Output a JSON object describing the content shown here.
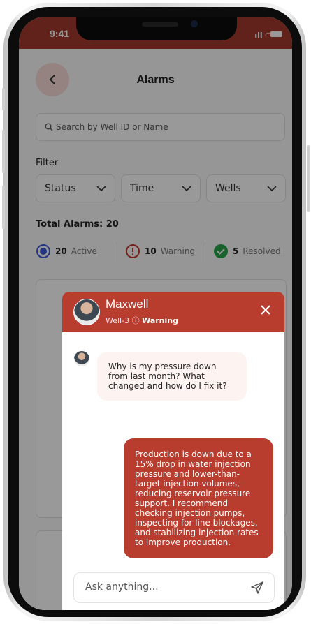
{
  "status_bar": {
    "time": "9:41"
  },
  "header": {
    "title": "Alarms",
    "back_icon": "chevron-left-icon"
  },
  "search": {
    "placeholder": "Search by Well ID or Name"
  },
  "filter": {
    "label": "Filter",
    "dropdowns": [
      {
        "label": "Status"
      },
      {
        "label": "Time"
      },
      {
        "label": "Wells"
      }
    ]
  },
  "total_alarms": "Total Alarms: 20",
  "stats": [
    {
      "count": "20",
      "label": "Active",
      "color": "#3d5bd9"
    },
    {
      "count": "10",
      "label": "Warning",
      "color": "#c0392b"
    },
    {
      "count": "5",
      "label": "Resolved",
      "color": "#27a348"
    }
  ],
  "chat": {
    "contact_name": "Maxwell",
    "well": "Well-3",
    "status": "Warning",
    "messages": [
      {
        "from": "user",
        "text": "Why is my pressure down from last month? What changed and how do I fix it?"
      },
      {
        "from": "assistant",
        "text": "Production is down due to a 15% drop in water injection pressure and lower-than-target injection volumes, reducing reservoir pressure support. I recommend checking injection pumps, inspecting for line blockages, and stabilizing injection rates to improve production."
      }
    ],
    "input_placeholder": "Ask anything...",
    "accent": "#b83d2f"
  }
}
